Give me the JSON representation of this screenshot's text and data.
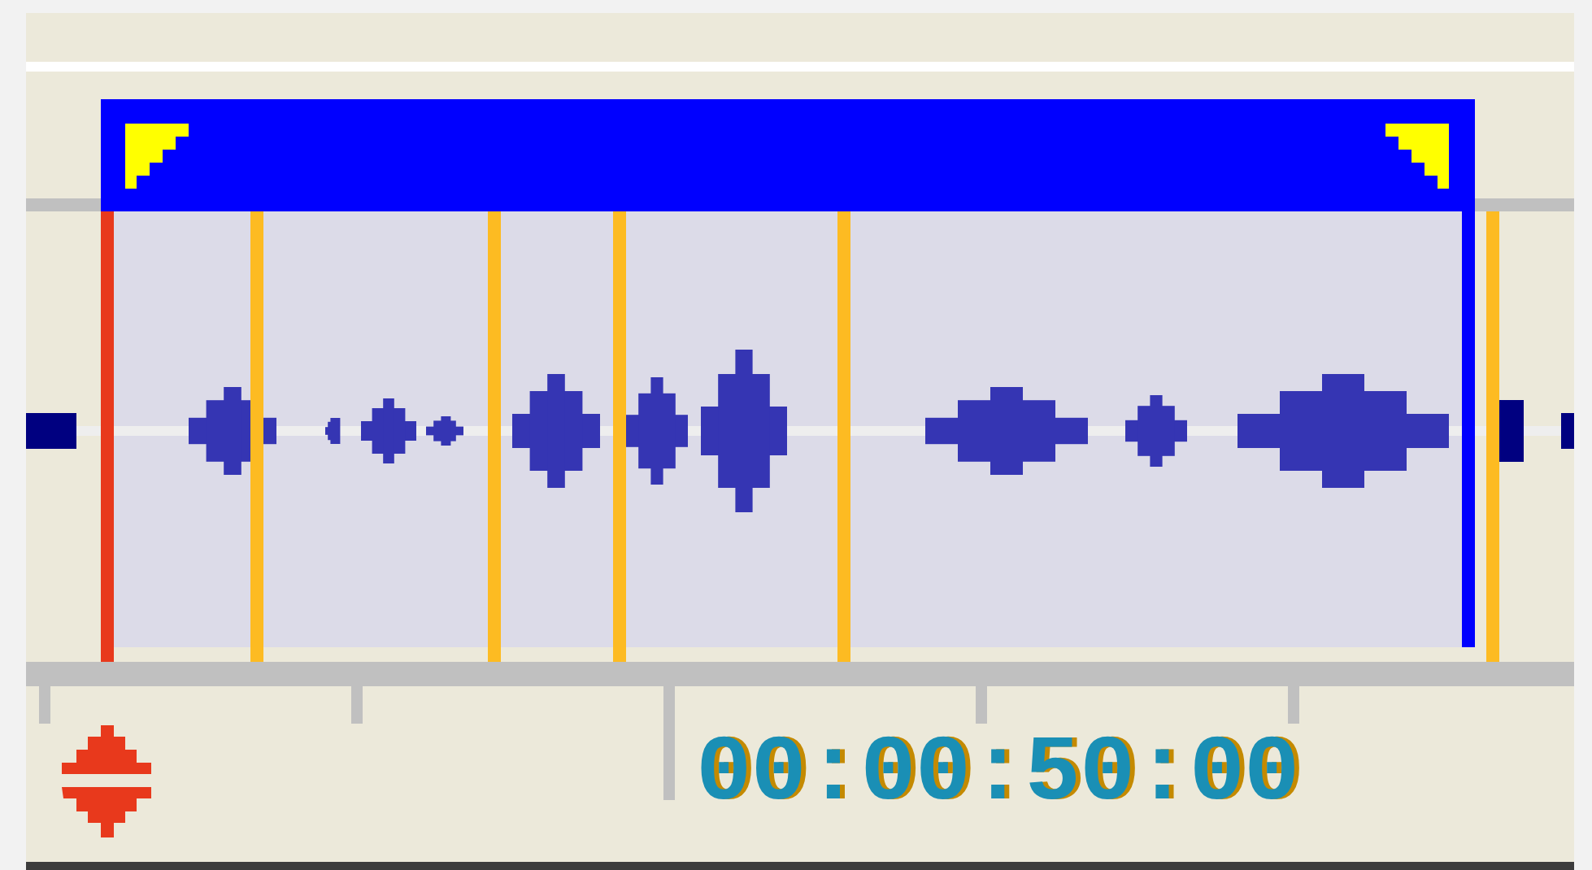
{
  "timecode": "00:00:50:00"
}
